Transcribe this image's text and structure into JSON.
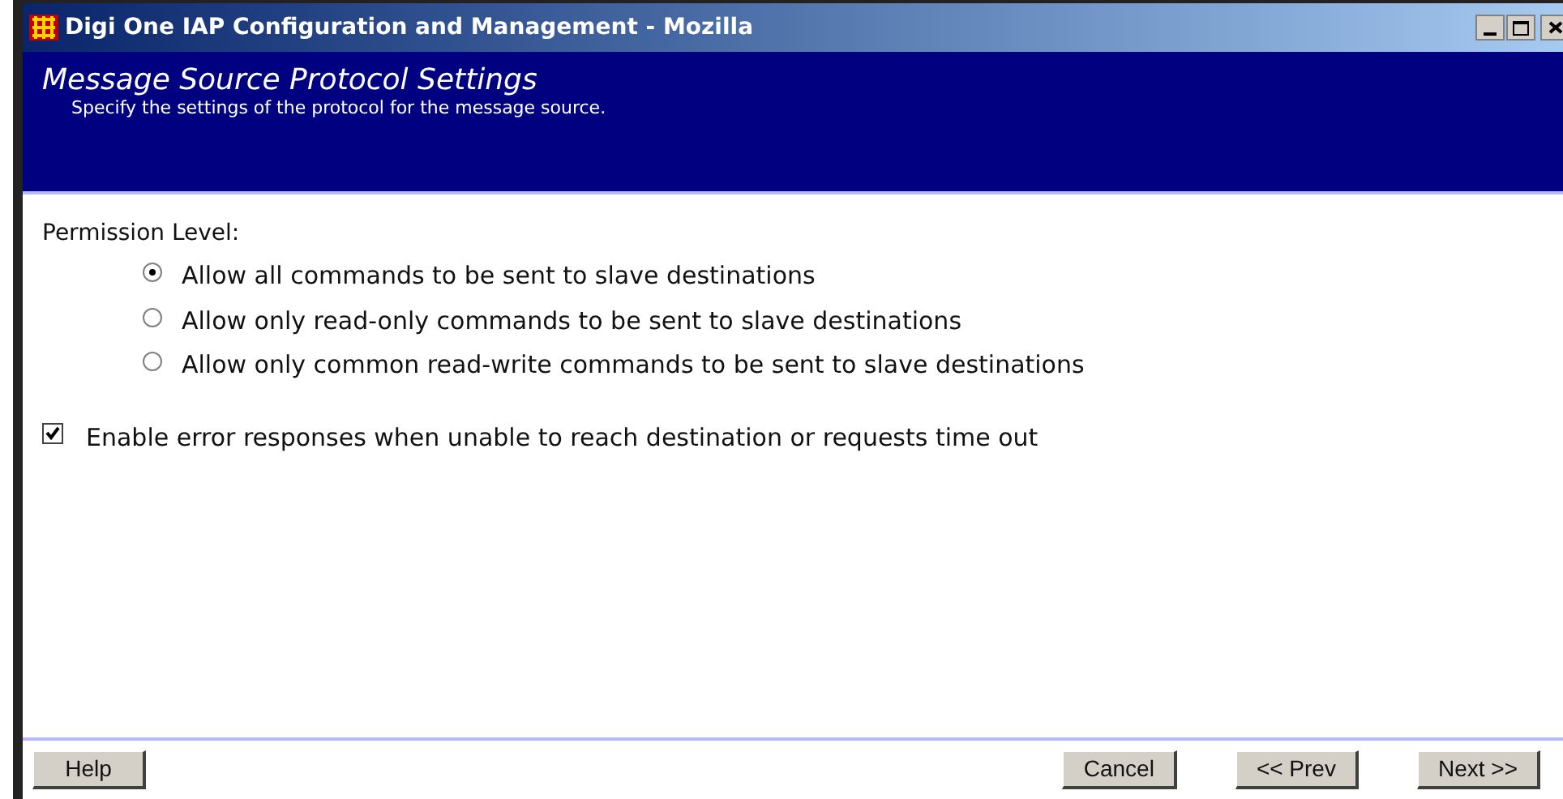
{
  "window": {
    "title": "Digi One IAP Configuration and Management - Mozilla"
  },
  "header": {
    "title": "Message Source Protocol Settings",
    "subtitle": "Specify the settings of the protocol for the message source."
  },
  "permission": {
    "label": "Permission Level:",
    "options": [
      {
        "label": "Allow all commands to be sent to slave destinations",
        "selected": true
      },
      {
        "label": "Allow only read-only commands to be sent to slave destinations",
        "selected": false
      },
      {
        "label": "Allow only common read-write commands to be sent to slave destinations",
        "selected": false
      }
    ]
  },
  "error_responses": {
    "label": "Enable error responses when unable to reach destination or requests time out",
    "checked": true
  },
  "buttons": [
    {
      "kind": "left",
      "label": "Help"
    },
    {
      "kind": "right",
      "label": "Cancel"
    },
    {
      "kind": "right",
      "label": "<< Prev"
    },
    {
      "kind": "right",
      "label": "Next >>"
    }
  ]
}
